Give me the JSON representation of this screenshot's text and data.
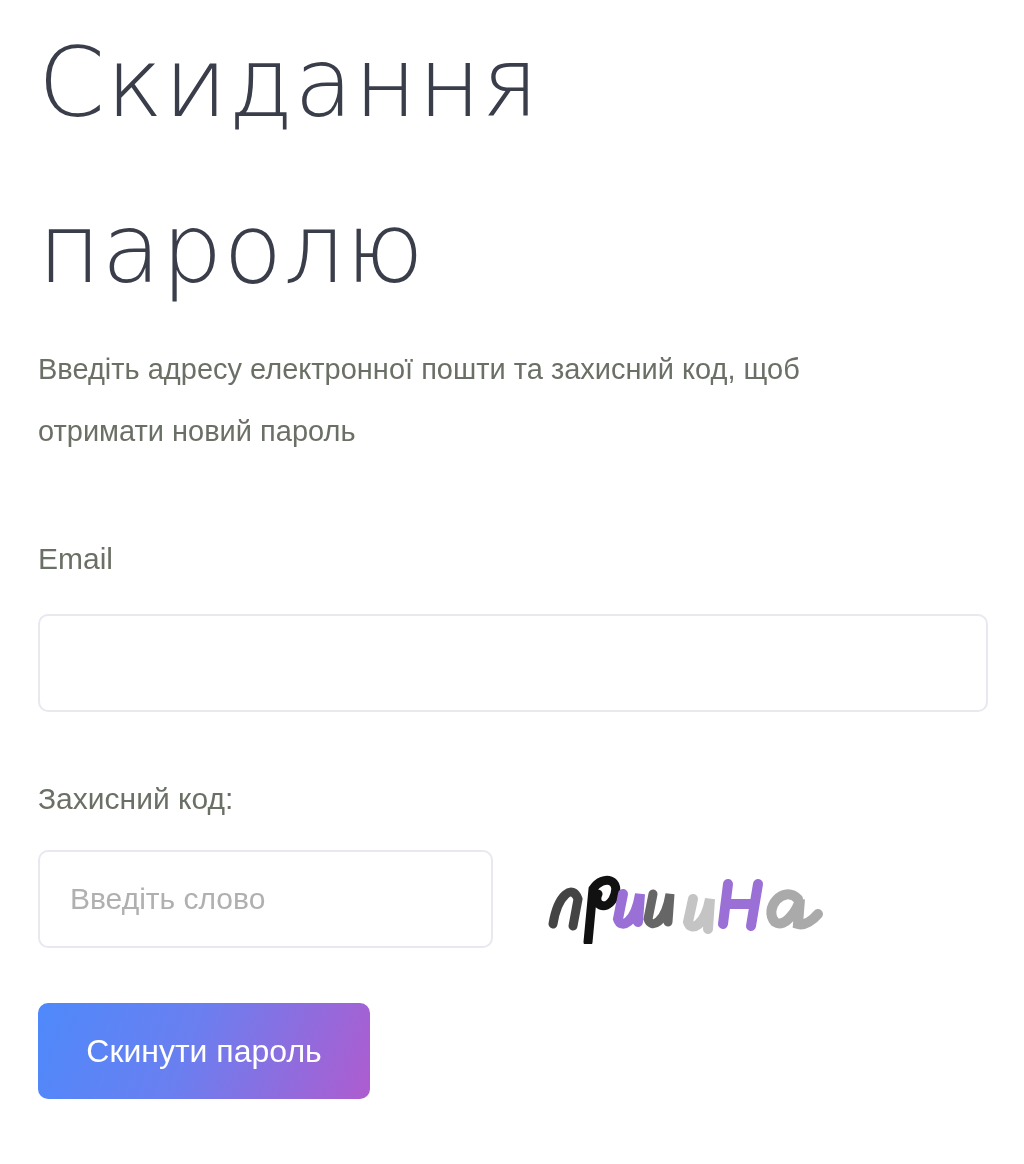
{
  "title": "Скидання паролю",
  "subtitle": "Введіть адресу електронної пошти та захисний код, щоб отримати новий пароль",
  "email": {
    "label": "Email"
  },
  "captcha": {
    "label": "Захисний код:",
    "placeholder": "Введіть слово"
  },
  "submit": "Скинути пароль"
}
